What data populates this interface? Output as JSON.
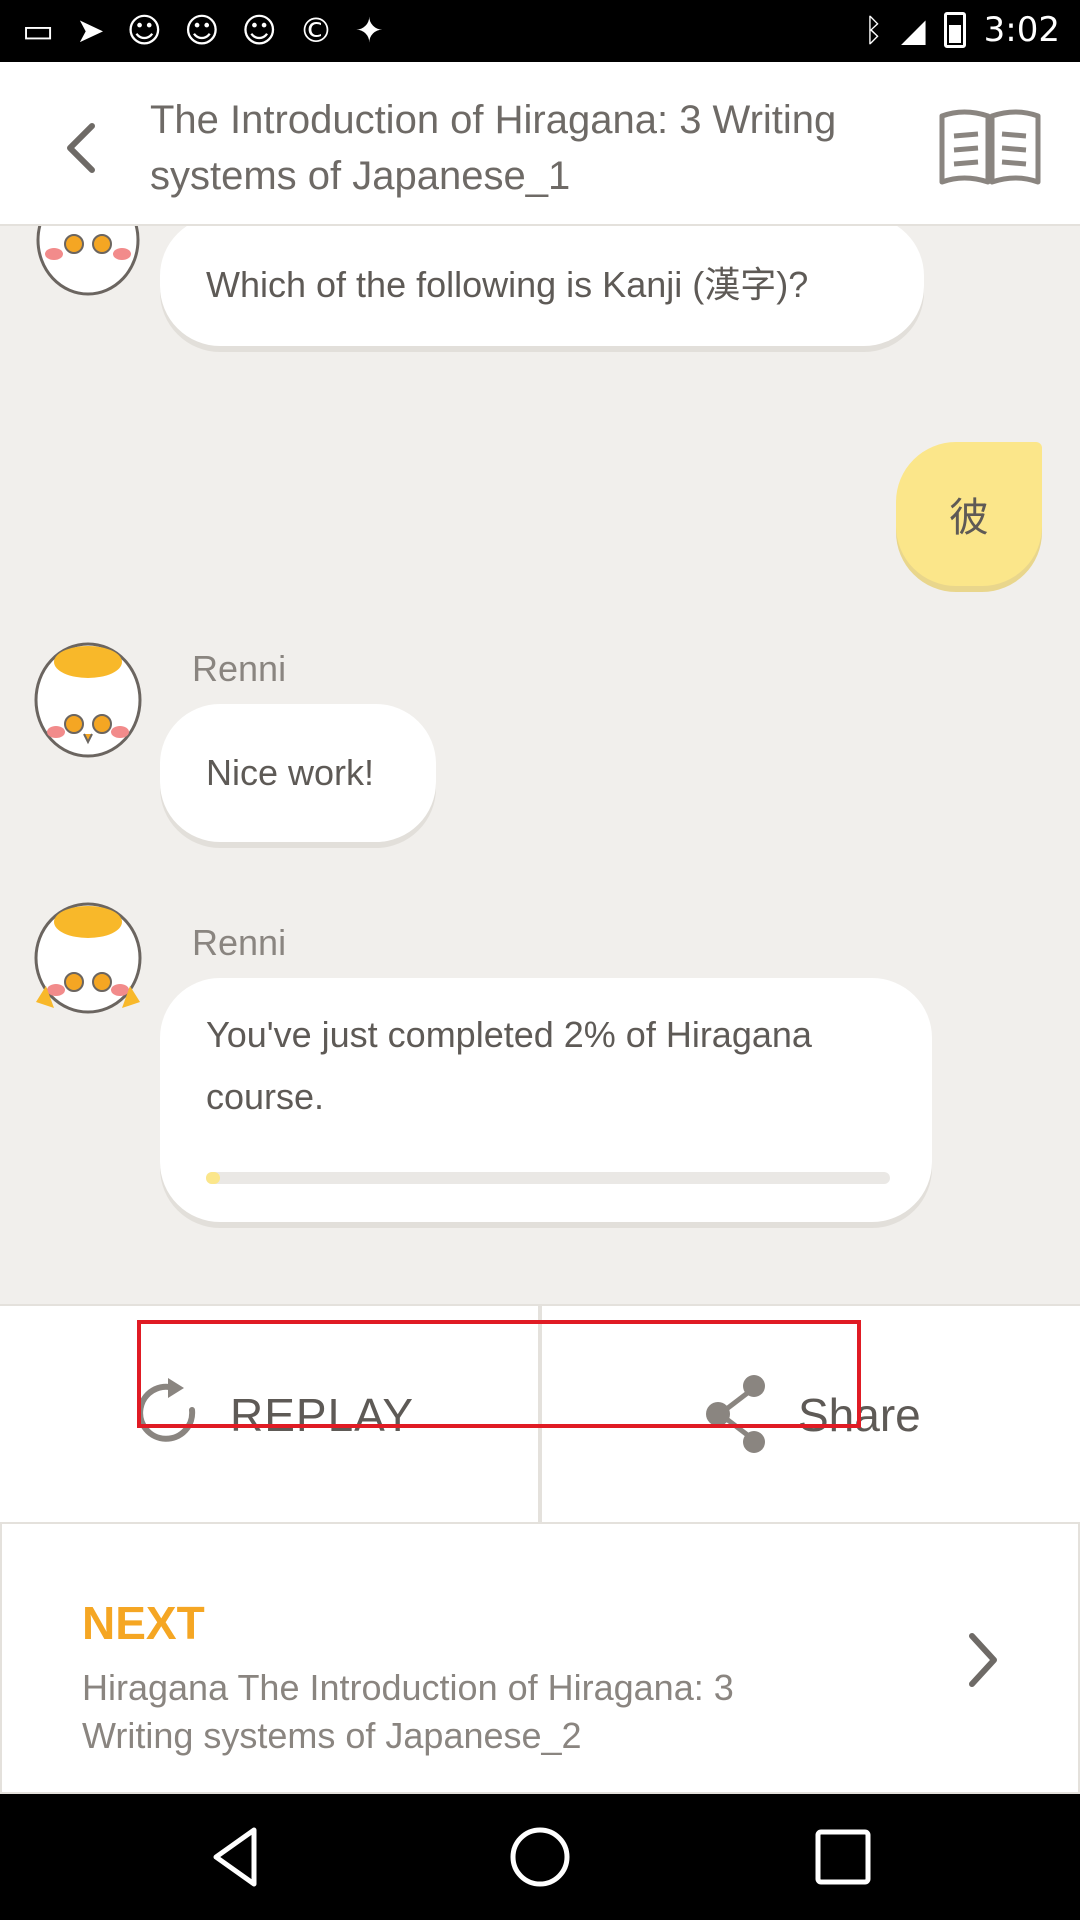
{
  "status_bar": {
    "time": "3:02",
    "left_icons": [
      "chat-icon",
      "navigation-icon",
      "cat-icon",
      "cat-icon",
      "cat-icon",
      "copyright-icon",
      "fake-gps-icon"
    ],
    "right_icons": [
      "bluetooth-icon",
      "signal-icon",
      "battery-icon"
    ]
  },
  "header": {
    "title": "The Introduction of Hiragana: 3 Writing systems of Japanese_1"
  },
  "chat": {
    "question": "Which of the following is Kanji (漢字)?",
    "answer": "彼",
    "messages": [
      {
        "sender": "Renni",
        "text": "Nice work!"
      },
      {
        "sender": "Renni",
        "text": "You've just completed 2% of Hiragana course.",
        "progress_percent": 2
      }
    ]
  },
  "actions": {
    "replay_label": "REPLAY",
    "share_label": "Share"
  },
  "next": {
    "label": "NEXT",
    "description": "Hiragana The Introduction of Hiragana: 3 Writing systems of Japanese_2"
  },
  "colors": {
    "accent": "#f5a623",
    "answer_bubble": "#fbe68a",
    "background": "#f1efec",
    "highlight": "#e01b24"
  }
}
